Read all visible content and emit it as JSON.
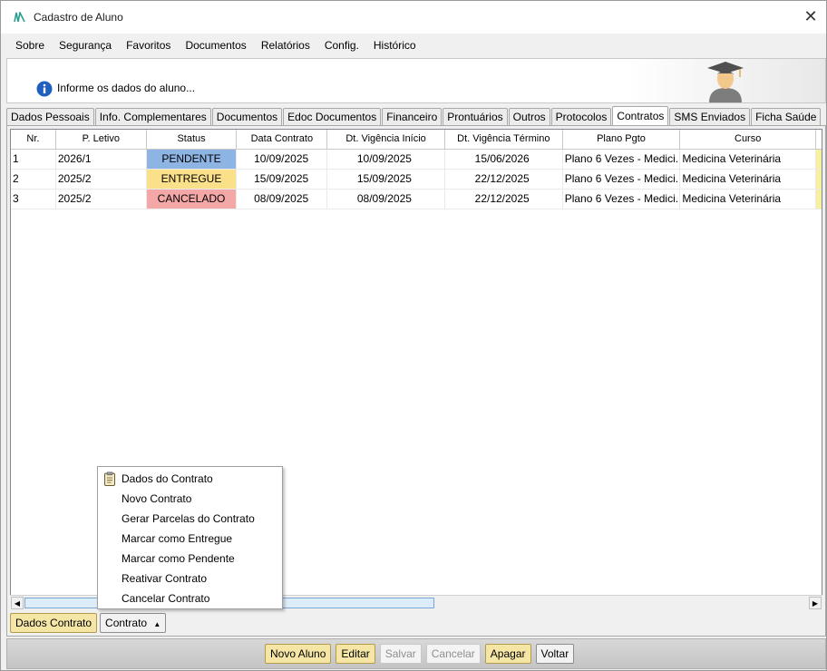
{
  "window": {
    "title": "Cadastro de Aluno"
  },
  "menu": [
    "Sobre",
    "Segurança",
    "Favoritos",
    "Documentos",
    "Relatórios",
    "Config.",
    "Histórico"
  ],
  "header": {
    "info_text": "Informe os dados do aluno..."
  },
  "tabs": [
    "Dados Pessoais",
    "Info. Complementares",
    "Documentos",
    "Edoc Documentos",
    "Financeiro",
    "Prontuários",
    "Outros",
    "Protocolos",
    "Contratos",
    "SMS Enviados",
    "Ficha Saúde"
  ],
  "active_tab": "Contratos",
  "grid": {
    "columns": [
      "Nr.",
      "P. Letivo",
      "Status",
      "Data Contrato",
      "Dt. Vigência Início",
      "Dt. Vigência Término",
      "Plano Pgto",
      "Curso"
    ],
    "rows": [
      {
        "nr": "1",
        "periodo": "2026/1",
        "status": "PENDENTE",
        "status_color": "#8eb4e3",
        "data": "10/09/2025",
        "inicio": "10/09/2025",
        "termino": "15/06/2026",
        "plano": "Plano 6 Vezes - Medici...",
        "curso": "Medicina Veterinária"
      },
      {
        "nr": "2",
        "periodo": "2025/2",
        "status": "ENTREGUE",
        "status_color": "#fbe08a",
        "data": "15/09/2025",
        "inicio": "15/09/2025",
        "termino": "22/12/2025",
        "plano": "Plano 6 Vezes - Medici...",
        "curso": "Medicina Veterinária"
      },
      {
        "nr": "3",
        "periodo": "2025/2",
        "status": "CANCELADO",
        "status_color": "#f4a7a7",
        "data": "08/09/2025",
        "inicio": "08/09/2025",
        "termino": "22/12/2025",
        "plano": "Plano 6 Vezes - Medici...",
        "curso": "Medicina Veterinária"
      }
    ]
  },
  "context_menu": {
    "items": [
      "Dados do Contrato",
      "Novo Contrato",
      "Gerar Parcelas do Contrato",
      "Marcar como Entregue",
      "Marcar como Pendente",
      "Reativar Contrato",
      "Cancelar Contrato"
    ]
  },
  "sub_buttons": {
    "dados_contrato": "Dados Contrato",
    "contrato": "Contrato",
    "contrato_arrow": "▲"
  },
  "footer_buttons": {
    "novo_aluno": "Novo Aluno",
    "editar": "Editar",
    "salvar": "Salvar",
    "cancelar": "Cancelar",
    "apagar": "Apagar",
    "voltar": "Voltar"
  },
  "colors": {
    "accent_yellow": "#f5e6a6",
    "info_blue": "#1f5fbf"
  }
}
